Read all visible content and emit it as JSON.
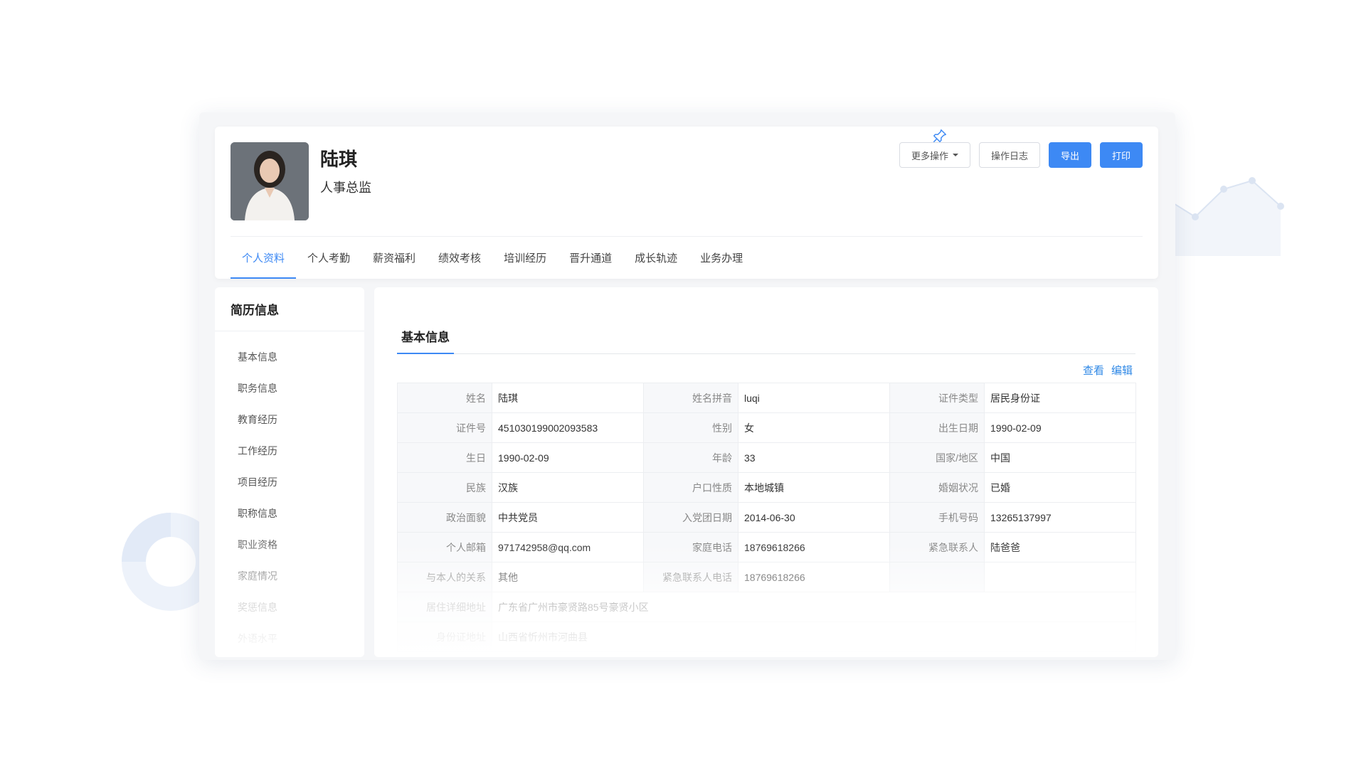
{
  "profile": {
    "name": "陆琪",
    "title": "人事总监"
  },
  "toolbar": {
    "more_label": "更多操作",
    "log_label": "操作日志",
    "export_label": "导出",
    "print_label": "打印"
  },
  "tabs": [
    {
      "label": "个人资料"
    },
    {
      "label": "个人考勤"
    },
    {
      "label": "薪资福利"
    },
    {
      "label": "绩效考核"
    },
    {
      "label": "培训经历"
    },
    {
      "label": "晋升通道"
    },
    {
      "label": "成长轨迹"
    },
    {
      "label": "业务办理"
    }
  ],
  "sidebar": {
    "title": "简历信息",
    "items": [
      {
        "label": "基本信息"
      },
      {
        "label": "职务信息"
      },
      {
        "label": "教育经历"
      },
      {
        "label": "工作经历"
      },
      {
        "label": "项目经历"
      },
      {
        "label": "职称信息"
      },
      {
        "label": "职业资格"
      },
      {
        "label": "家庭情况"
      },
      {
        "label": "奖惩信息"
      },
      {
        "label": "外语水平"
      }
    ]
  },
  "section": {
    "title": "基本信息",
    "view_label": "查看",
    "edit_label": "编辑"
  },
  "table": {
    "rows": [
      [
        {
          "label": "姓名",
          "value": "陆琪"
        },
        {
          "label": "姓名拼音",
          "value": "luqi"
        },
        {
          "label": "证件类型",
          "value": "居民身份证"
        }
      ],
      [
        {
          "label": "证件号",
          "value": "451030199002093583"
        },
        {
          "label": "性别",
          "value": "女"
        },
        {
          "label": "出生日期",
          "value": "1990-02-09"
        }
      ],
      [
        {
          "label": "生日",
          "value": "1990-02-09"
        },
        {
          "label": "年龄",
          "value": "33"
        },
        {
          "label": "国家/地区",
          "value": "中国"
        }
      ],
      [
        {
          "label": "民族",
          "value": "汉族"
        },
        {
          "label": "户口性质",
          "value": "本地城镇"
        },
        {
          "label": "婚姻状况",
          "value": "已婚"
        }
      ],
      [
        {
          "label": "政治面貌",
          "value": "中共党员"
        },
        {
          "label": "入党团日期",
          "value": "2014-06-30"
        },
        {
          "label": "手机号码",
          "value": "13265137997"
        }
      ],
      [
        {
          "label": "个人邮箱",
          "value": "971742958@qq.com"
        },
        {
          "label": "家庭电话",
          "value": "18769618266"
        },
        {
          "label": "紧急联系人",
          "value": "陆爸爸"
        }
      ],
      [
        {
          "label": "与本人的关系",
          "value": "其他"
        },
        {
          "label": "紧急联系人电话",
          "value": "18769618266"
        },
        {
          "label": "",
          "value": ""
        }
      ]
    ],
    "address_rows": [
      {
        "label": "居住详细地址",
        "value": "广东省广州市豪贤路85号豪贤小区"
      },
      {
        "label": "身份证地址",
        "value": "山西省忻州市河曲县"
      }
    ]
  },
  "colors": {
    "accent": "#3d89f4",
    "link": "#2f88e6",
    "label": "#888888"
  }
}
